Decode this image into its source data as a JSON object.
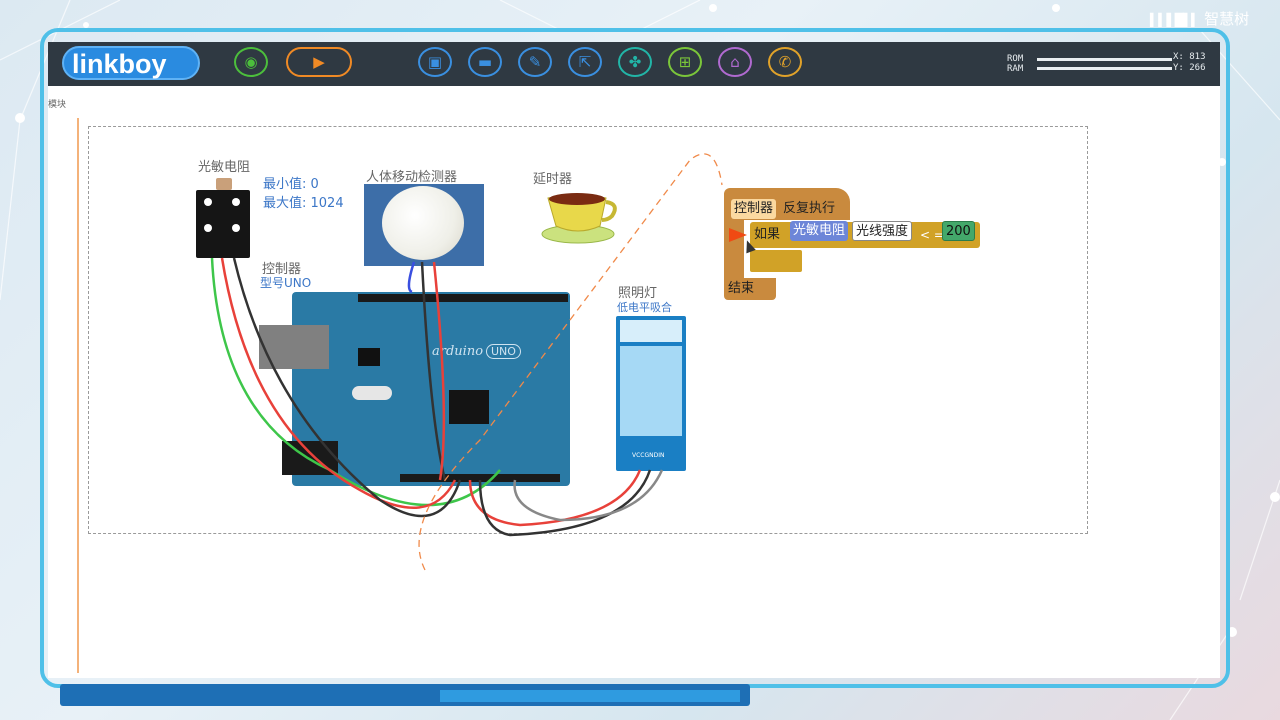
{
  "app": {
    "logo": "linkboy",
    "watermark": "智慧树"
  },
  "toolbar": {
    "buttons": [
      {
        "name": "view-icon",
        "color": "#4cbf3c"
      },
      {
        "name": "run-icon",
        "color": "#f08a25"
      },
      {
        "name": "save-icon",
        "color": "#3a8fe0"
      },
      {
        "name": "open-folder-icon",
        "color": "#3a8fe0"
      },
      {
        "name": "edit-icon",
        "color": "#3a8fe0"
      },
      {
        "name": "export-icon",
        "color": "#3a8fe0"
      },
      {
        "name": "python-icon",
        "color": "#22b5a7"
      },
      {
        "name": "grid-icon",
        "color": "#7bc63a"
      },
      {
        "name": "home-icon",
        "color": "#b06ad0"
      },
      {
        "name": "phone-icon",
        "color": "#e0a22a"
      }
    ]
  },
  "memory": {
    "rom_label": "ROM",
    "ram_label": "RAM",
    "x_readout": "X: 813",
    "y_readout": "Y: 266"
  },
  "sidebar": {
    "tab_text": "模块"
  },
  "canvas": {
    "ldr": {
      "title": "光敏电阻",
      "min_value": "最小值: 0",
      "max_value": "最大值: 1024"
    },
    "pir": {
      "title": "人体移动检测器"
    },
    "timer": {
      "title": "延时器"
    },
    "controller": {
      "title": "控制器",
      "model": "型号UNO"
    },
    "lamp": {
      "title": "照明灯",
      "mode": "低电平吸合"
    },
    "board_text": "arduino",
    "board_model": "UNO",
    "relay_pins": "VCCGNDIN"
  },
  "code": {
    "controller": "控制器",
    "loop": "反复执行",
    "if": "如果",
    "sensor": "光敏电阻",
    "property": "光线强度",
    "operator": "< =",
    "value": "200",
    "end": "结束"
  },
  "colors": {
    "frame": "#4fc0e8",
    "toolbar": "#2f3942",
    "logo": "#2a8be0",
    "block_controller": "#c98a3e",
    "block_if": "#d1a227",
    "block_sensor": "#6d86d8",
    "block_number": "#43a86a"
  }
}
